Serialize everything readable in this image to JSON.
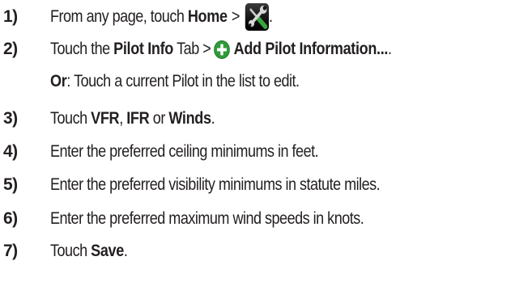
{
  "steps": [
    {
      "number": "1)",
      "text_before": "From any page, touch ",
      "bold": "Home",
      "separator": ">",
      "icon": "wrench-screwdriver-icon",
      "text_after": "."
    },
    {
      "number": "2)",
      "text_before": "Touch the ",
      "bold": "Pilot Info",
      "text_mid": " Tab ",
      "separator": ">",
      "icon": "green-plus-icon",
      "bold_2": "Add Pilot Information...",
      "text_after": "."
    },
    {
      "number": "",
      "bold": "Or",
      "text_after": ": Touch a current Pilot in the list to edit."
    },
    {
      "number": "3)",
      "text_before": "Touch ",
      "bold": "VFR",
      "text_mid": ", ",
      "bold_2": "IFR",
      "text_mid_2": " or ",
      "bold_3": "Winds",
      "text_after": "."
    },
    {
      "number": "4)",
      "text": "Enter the preferred ceiling minimums in feet."
    },
    {
      "number": "5)",
      "text": "Enter the preferred visibility minimums in statute miles."
    },
    {
      "number": "6)",
      "text": "Enter the preferred maximum wind speeds in knots."
    },
    {
      "number": "7)",
      "text_before": "Touch ",
      "bold": "Save",
      "text_after": "."
    }
  ],
  "colors": {
    "text": "#231f20",
    "icon_background": "#111111",
    "plus_green": "#2f9b3a"
  }
}
